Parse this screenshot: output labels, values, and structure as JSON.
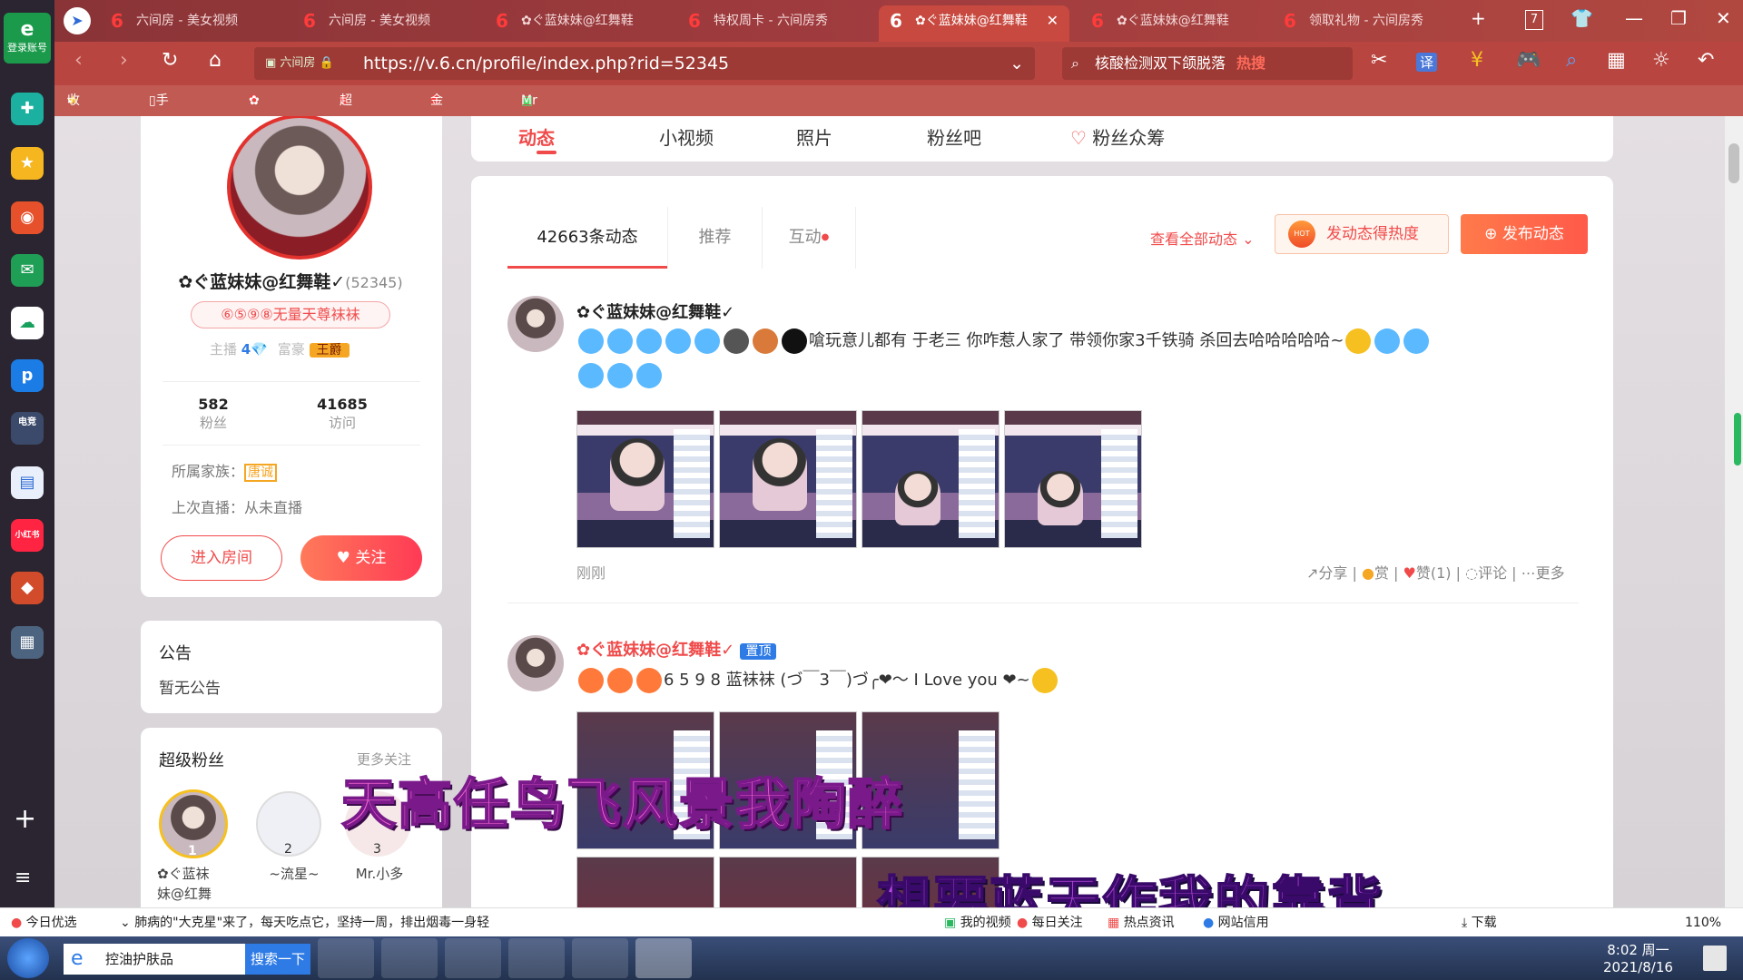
{
  "sidebar": {
    "login_icon_text": "e",
    "login_label": "登录账号",
    "items": [
      "plus-square-icon",
      "star-icon",
      "weibo-icon",
      "mail-icon",
      "cloud-icon",
      "p-app-icon",
      "esports-icon",
      "doc-icon",
      "xiaohongshu-icon",
      "game-icon",
      "tv-icon"
    ],
    "item_texts": [
      "✚",
      "★",
      "◉",
      "✉",
      "☁",
      "p",
      "电竞",
      "▤",
      "小红书",
      "◆",
      "▦"
    ],
    "plus": "+",
    "menu": "≡"
  },
  "tabs": [
    {
      "label": "六间房 - 美女视频"
    },
    {
      "label": "六间房 - 美女视频"
    },
    {
      "label": "✿ぐ蓝妹妹@红舞鞋"
    },
    {
      "label": "特权周卡 - 六间房秀"
    },
    {
      "label": "✿ぐ蓝妹妹@红舞鞋",
      "active": true
    },
    {
      "label": "✿ぐ蓝妹妹@红舞鞋"
    },
    {
      "label": "领取礼物 - 六间房秀"
    }
  ],
  "tab_count": "7",
  "six_logo": "6",
  "address": {
    "badge": "六间房",
    "url": "https://v.6.cn/profile/index.php?rid=52345"
  },
  "search": {
    "text": "核酸检测双下颌脱落",
    "hot": "热搜"
  },
  "bookmarks": {
    "favorites": "收藏",
    "mobile": "手机收藏夹",
    "b1": "✿ぐ蓝妹",
    "b2": "超级周卡",
    "b3": "金蟾捕鱼",
    "b4": "Mr小多"
  },
  "nav_tabs": [
    "动态",
    "小视频",
    "照片",
    "粉丝吧",
    "粉丝众筹"
  ],
  "profile": {
    "name": "✿ぐ蓝妹妹@红舞鞋✓",
    "rid": "(52345)",
    "title_tag": "⑥⑤⑨⑧无量天尊袜袜",
    "anchor_label": "主播",
    "anchor_level": "4",
    "rich_label": "富豪",
    "rich_title": "王爵",
    "fans_count": "582",
    "fans_label": "粉丝",
    "visits_count": "41685",
    "visits_label": "访问",
    "family_label": "所属家族：",
    "family_value": "唐诚",
    "last_live": "上次直播：从未直播",
    "enter_room": "进入房间",
    "follow": "关注"
  },
  "notice": {
    "title": "公告",
    "text": "暂无公告"
  },
  "super_fans": {
    "title": "超级粉丝",
    "more": "更多关注",
    "fans": [
      {
        "rank": "1",
        "name": "✿ぐ蓝袜\n妹@红舞"
      },
      {
        "rank": "2",
        "name": "~流星~"
      },
      {
        "rank": "3",
        "name": "Mr.小多"
      }
    ]
  },
  "feed": {
    "tabs": [
      "42663条动态",
      "推荐",
      "互动"
    ],
    "view_all": "查看全部动态",
    "heat_btn": "发动态得热度",
    "hot_badge": "HOT",
    "post_btn": "发布动态",
    "posts": [
      {
        "author": "✿ぐ蓝妹妹@红舞鞋✓",
        "text_line1": "嗆玩意儿都有 于老三 你咋惹人家了 带领你家3千铁骑 杀回去哈哈哈哈哈~",
        "time": "刚刚",
        "actions": [
          "分享",
          "赏",
          "赞(1)",
          "评论",
          "更多"
        ]
      },
      {
        "author": "✿ぐ蓝妹妹@红舞鞋✓",
        "pinned": "置顶",
        "text_line1": "6 5 9 8 蓝袜袜 (づ￣3￣)づ╭❤～ I Love you ❤~"
      }
    ]
  },
  "lyrics": {
    "line1": "天高任鸟飞风景我陶醉",
    "line2": "想要蓝天作我的靠背"
  },
  "statusbar": {
    "today": "今日优选",
    "news": "肺病的\"大克星\"来了，每天吃点它，坚持一周，排出烟毒一身轻",
    "items": [
      "我的视频",
      "每日关注",
      "热点资讯",
      "网站信用",
      "下载"
    ],
    "zoom": "110%"
  },
  "taskbar": {
    "app1": "控油护肤品",
    "search_btn": "搜索一下",
    "time": "8:02 周一",
    "date": "2021/8/16"
  }
}
